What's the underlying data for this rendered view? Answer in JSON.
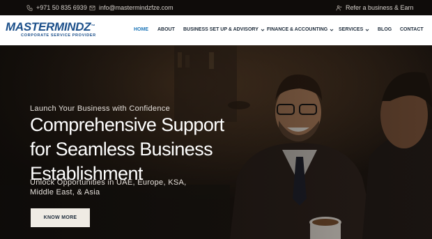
{
  "topbar": {
    "phone": "+971 50 835 6939",
    "email": "info@mastermindzfze.com",
    "referral": "Refer a business & Earn",
    "icons": [
      "phone-icon",
      "mail-icon",
      "users-icon"
    ]
  },
  "brand": {
    "name": "MASTERMINDZ",
    "trademark": "™",
    "tagline": "CORPORATE SERVICE PROVIDER",
    "color": "#1b4f8a"
  },
  "nav": {
    "items": [
      {
        "label": "HOME",
        "active": true
      },
      {
        "label": "ABOUT"
      },
      {
        "label": "BUSINESS SET UP & ADVISORY",
        "dropdown": true
      },
      {
        "label": "FINANCE & ACCOUNTING",
        "dropdown": true
      },
      {
        "label": "SERVICES",
        "dropdown": true
      },
      {
        "label": "BLOG"
      },
      {
        "label": "CONTACT"
      }
    ],
    "active_color": "#1d76b8"
  },
  "hero": {
    "eyebrow": "Launch Your Business with Confidence",
    "headline": "Comprehensive Support for Seamless Business Establishment",
    "subtext": "Unlock Opportunities in UAE, Europe, KSA, Middle East, & Asia",
    "cta_label": "KNOW MORE"
  }
}
